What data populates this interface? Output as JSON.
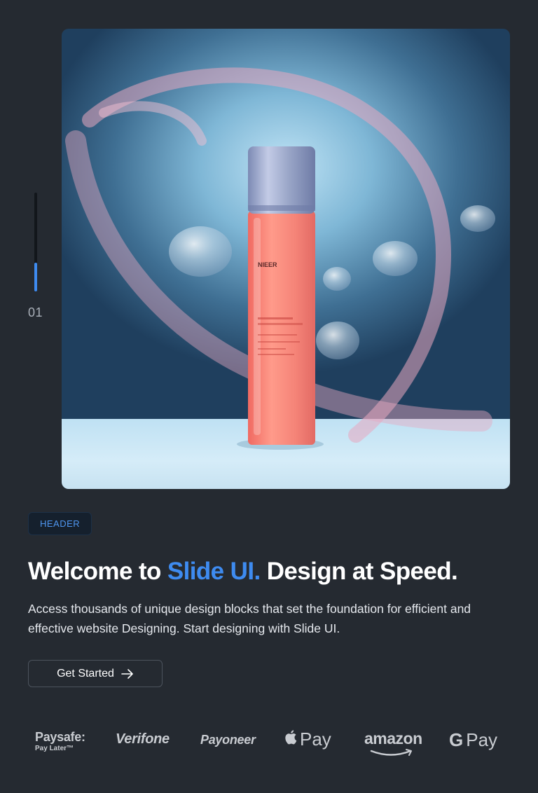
{
  "slider": {
    "current_slide_label": "01",
    "progress": 0.29
  },
  "hero": {
    "image_subject": "pink serum bottle with silver cap among floating water droplets",
    "bottle_brand_text": "NIEER",
    "colors": {
      "bottle": "#f58478",
      "cap": "#9aa6c8",
      "background": "#3f6f93"
    }
  },
  "badge": {
    "label": "HEADER"
  },
  "headline": {
    "part1": "Welcome to ",
    "accent": "Slide UI.",
    "part2": " Design at Speed."
  },
  "description": "Access thousands of unique design blocks that set the foundation for efficient and effective website Designing. Start designing with Slide UI.",
  "cta": {
    "label": "Get Started",
    "icon": "arrow-right-icon"
  },
  "partners": {
    "paysafe": {
      "main": "Paysafe:",
      "sub": "Pay Later™"
    },
    "verifone": "Verifone",
    "payoneer": "Payoneer",
    "apple_pay": "Pay",
    "amazon": "amazon",
    "google_pay": {
      "g": "G",
      "text": "Pay"
    }
  },
  "colors": {
    "page_bg": "#252a31",
    "accent": "#3e8bf0",
    "text_muted": "#a9afb8"
  }
}
